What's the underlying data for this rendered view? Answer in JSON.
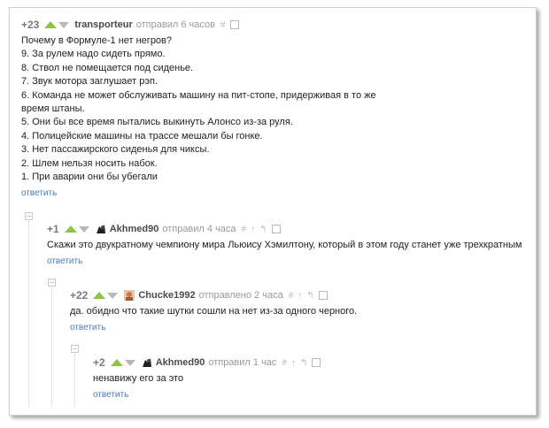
{
  "comments": [
    {
      "rating": "+23",
      "user": "transporteur",
      "action": "отправил 6 часов",
      "lines": [
        "Почему в Формуле-1 нет негров?",
        "9. За рулем надо сидеть прямо.",
        "8. Ствол не помещается под сиденье.",
        "7. Звук мотора заглушает рэп.",
        "6. Команда не может обслуживать машину на пит-стопе, придерживая в то же",
        "время штаны.",
        "5. Они бы все время пытались выкинуть Алонсо из-за руля.",
        "4. Полицейские машины на трассе мешали бы гонке.",
        "3. Нет пассажирского сиденья для чиксы.",
        "2. Шлем нельзя носить набок.",
        "1. При аварии они бы убегали"
      ],
      "reply": "ответить"
    },
    {
      "rating": "+1",
      "user": "Akhmed90",
      "action": "отправил 4 часа",
      "lines": [
        "Скажи это двукратному чемпиону мира Льюису Хэмилтону, который в этом году станет уже трехкратным"
      ],
      "reply": "ответить"
    },
    {
      "rating": "+22",
      "user": "Chucke1992",
      "action": "отправлено 2 часа",
      "lines": [
        "да. обидно что такие шутки сошли на нет из-за одного черного."
      ],
      "reply": "ответить"
    },
    {
      "rating": "+2",
      "user": "Akhmed90",
      "action": "отправил 1 час",
      "lines": [
        "ненавижу его за это"
      ],
      "reply": "ответить"
    }
  ],
  "icons": {
    "hash": "#",
    "up_arrow": "↑",
    "reply_arrow": "↰"
  },
  "colors": {
    "upvote": "#8cc63f",
    "link": "#4a7bb5"
  }
}
